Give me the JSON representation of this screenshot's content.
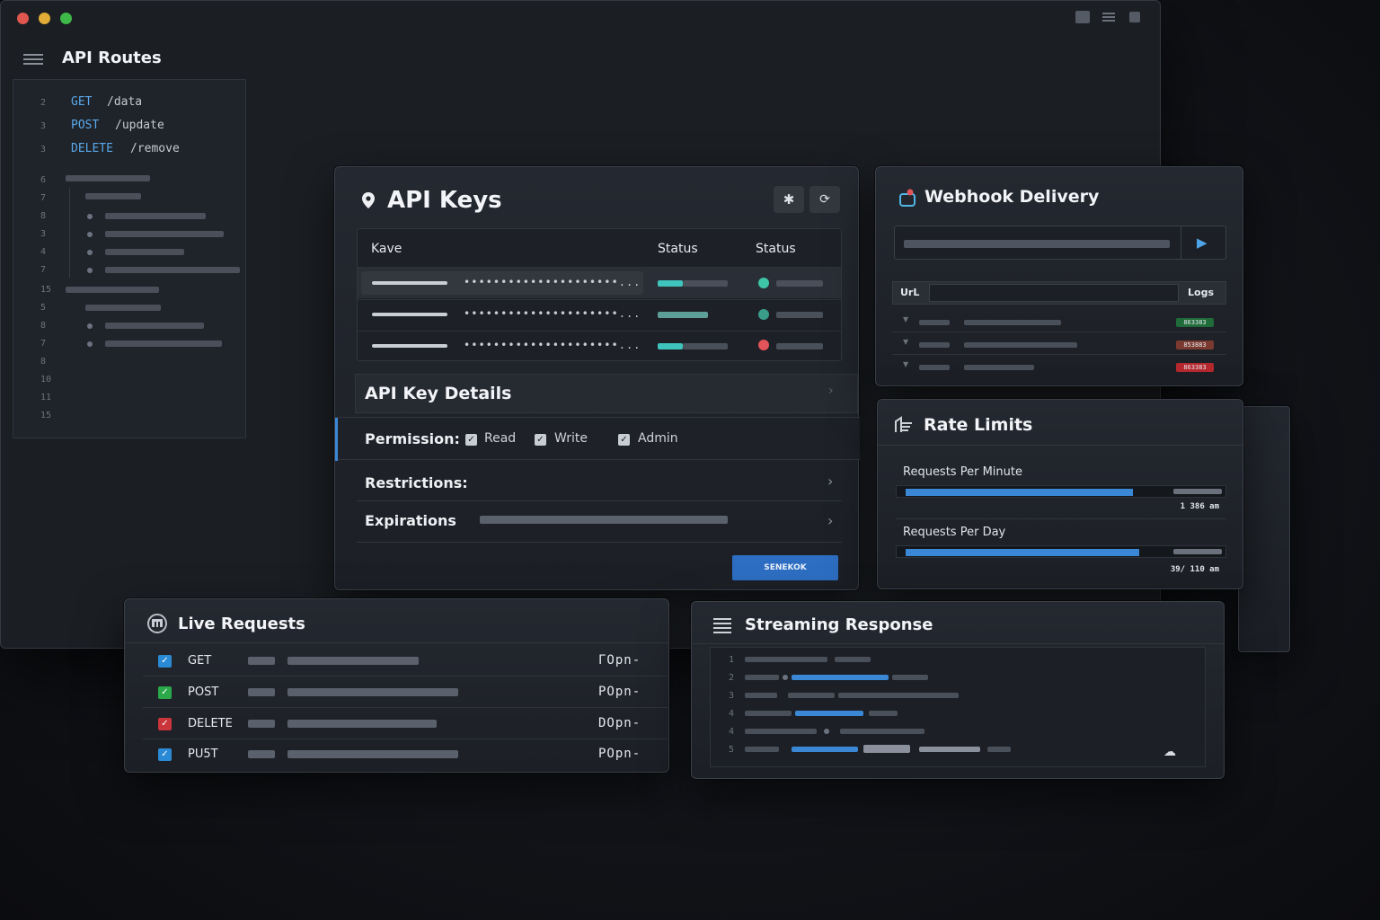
{
  "routes": {
    "title": "API Routes",
    "items": [
      {
        "line": "2",
        "method": "GET",
        "path": "/data"
      },
      {
        "line": "3",
        "method": "POST",
        "path": "/update"
      },
      {
        "line": "3",
        "method": "DELETE",
        "path": "/remove"
      }
    ],
    "line_numbers": [
      "6",
      "7",
      "8",
      "3",
      "4",
      "7",
      "15",
      "5",
      "8",
      "7",
      "8",
      "10",
      "11",
      "15"
    ]
  },
  "api_keys": {
    "title": "API Keys",
    "columns": [
      "Kave",
      "Status",
      "Status"
    ],
    "rows": [
      {
        "key": "•••••••••••••••••••••...",
        "status_color": "#3ec4a6"
      },
      {
        "key": "•••••••••••••••••••••...",
        "status_color": "#3a9d8a"
      },
      {
        "key": "•••••••••••••••••••••...",
        "status_color": "#e0545a"
      }
    ],
    "details_title": "API Key Details",
    "permission_label": "Permission:",
    "permissions": [
      "Read",
      "Write",
      "Admin"
    ],
    "restrictions_label": "Restrictions:",
    "expirations_label": "Expirations",
    "action_button": "SENEKOK"
  },
  "webhook": {
    "title": "Webhook Delivery",
    "url_label": "UrL",
    "logs_label": "Logs",
    "badges": [
      {
        "text": "863383",
        "color": "#1f6b3a"
      },
      {
        "text": "853883",
        "color": "#7a3a30"
      },
      {
        "text": "863383",
        "color": "#b5282e"
      }
    ]
  },
  "rate_limits": {
    "title": "Rate Limits",
    "items": [
      {
        "label": "Requests Per Minute",
        "value_text": "1 386 am",
        "fill": 0.72
      },
      {
        "label": "Requests Per Day",
        "value_text": "39/ 110 am",
        "fill": 0.74
      }
    ]
  },
  "live_requests": {
    "title": "Live Requests",
    "rows": [
      {
        "method": "GET",
        "status": "ГOpn-",
        "icon_color": "#2b8ad6"
      },
      {
        "method": "POST",
        "status": "POpn-",
        "icon_color": "#2aa84a"
      },
      {
        "method": "DELETE",
        "status": "DOpn-",
        "icon_color": "#c9353b"
      },
      {
        "method": "PU5T",
        "status": "POpn-",
        "icon_color": "#2b8ad6"
      }
    ]
  },
  "streaming": {
    "title": "Streaming Response",
    "line_numbers": [
      "1",
      "2",
      "3",
      "4",
      "4",
      "5"
    ]
  },
  "colors": {
    "accent": "#3a87d6",
    "teal": "#3ec4bc"
  }
}
